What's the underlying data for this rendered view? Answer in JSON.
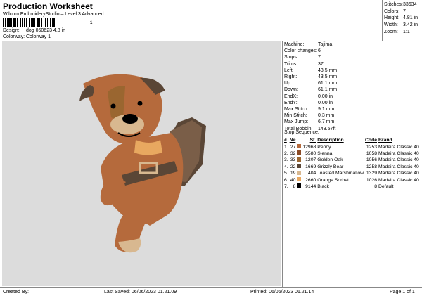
{
  "header": {
    "title": "Production Worksheet",
    "subtitle": "Wilcom EmbroideryStudio – Level 3 Advanced",
    "barcode_number": "1"
  },
  "design_info": [
    {
      "label": "Design:",
      "value": "dog 050623 4,8 in"
    },
    {
      "label": "Colorway:",
      "value": "Colorway 1"
    }
  ],
  "stats": [
    {
      "label": "Stitches:",
      "value": "33634"
    },
    {
      "label": "Colors:",
      "value": "7"
    },
    {
      "label": "Height:",
      "value": "4.81 in"
    },
    {
      "label": "Width:",
      "value": "3.42 in"
    },
    {
      "label": "Zoom:",
      "value": "1:1"
    }
  ],
  "params": [
    {
      "label": "Machine:",
      "value": "Tajima"
    },
    {
      "label": "Color changes:",
      "value": "6"
    },
    {
      "label": "Stops:",
      "value": "7"
    },
    {
      "label": "Trims:",
      "value": "37"
    },
    {
      "label": "Left:",
      "value": "43.5 mm"
    },
    {
      "label": "Right:",
      "value": "43.5 mm"
    },
    {
      "label": "Up:",
      "value": "61.1 mm"
    },
    {
      "label": "Down:",
      "value": "61.1 mm"
    },
    {
      "label": "EndX:",
      "value": "0.00 in"
    },
    {
      "label": "EndY:",
      "value": "0.00 in"
    },
    {
      "label": "Max Stitch:",
      "value": "9.1 mm"
    },
    {
      "label": "Min Stitch:",
      "value": "0.3 mm"
    },
    {
      "label": "Max Jump:",
      "value": "6.7 mm"
    },
    {
      "label": "Total Bobbin:",
      "value": "143.57ft"
    }
  ],
  "stop_sequence": {
    "title": "Stop Sequence:",
    "headers": [
      "#",
      "N#",
      "",
      "St.",
      "Description",
      "Code",
      "Brand"
    ],
    "rows": [
      {
        "num": "1.",
        "n": "27",
        "color": "#b56a3c",
        "st": "12968",
        "desc": "Penny",
        "code": "1253",
        "brand": "Madeira Classic 40"
      },
      {
        "num": "2.",
        "n": "32",
        "color": "#8a4a26",
        "st": "5580",
        "desc": "Sienna",
        "code": "1058",
        "brand": "Madeira Classic 40"
      },
      {
        "num": "3.",
        "n": "33",
        "color": "#9a6630",
        "st": "1207",
        "desc": "Golden Oak",
        "code": "1056",
        "brand": "Madeira Classic 40"
      },
      {
        "num": "4.",
        "n": "22",
        "color": "#5a4636",
        "st": "1669",
        "desc": "Grizzly Bear",
        "code": "1258",
        "brand": "Madeira Classic 40"
      },
      {
        "num": "5.",
        "n": "19",
        "color": "#d8b890",
        "st": "404",
        "desc": "Toasted Marshmallow",
        "code": "1329",
        "brand": "Madeira Classic 40"
      },
      {
        "num": "6.",
        "n": "40",
        "color": "#e8a860",
        "st": "2660",
        "desc": "Orange Sorbet",
        "code": "1026",
        "brand": "Madeira Classic 40"
      },
      {
        "num": "7.",
        "n": "8",
        "color": "#000000",
        "st": "9144",
        "desc": "Black",
        "code": "8",
        "brand": "Default"
      }
    ]
  },
  "footer": {
    "created_by": "Created By:",
    "last_saved": "Last Saved: 06/06/2023 01.21.09",
    "printed": "Printed: 06/06/2023 01.21.14",
    "page": "Page 1 of 1"
  }
}
